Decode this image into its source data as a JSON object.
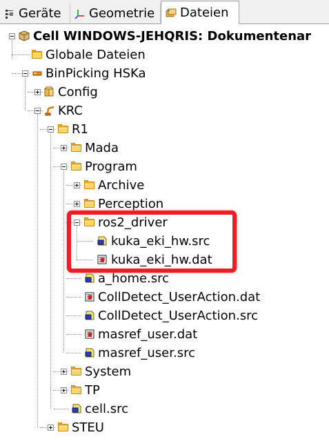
{
  "tabs": [
    {
      "label": "Geräte",
      "icon": "devices-icon",
      "active": false
    },
    {
      "label": "Geometrie",
      "icon": "geometry-axes-icon",
      "active": false
    },
    {
      "label": "Dateien",
      "icon": "files-icon",
      "active": true
    }
  ],
  "tree": {
    "cell": "Cell WINDOWS-JEHQRIS: Dokumentenar",
    "global_files": "Globale Dateien",
    "project": "BinPicking HSKa",
    "config": "Config",
    "krc": "KRC",
    "r1": "R1",
    "mada": "Mada",
    "program": "Program",
    "archive": "Archive",
    "perception": "Perception",
    "ros2_driver": "ros2_driver",
    "kuka_eki_hw_src": "kuka_eki_hw.src",
    "kuka_eki_hw_dat": "kuka_eki_hw.dat",
    "a_home_src": "a_home.src",
    "colldetect_dat": "CollDetect_UserAction.dat",
    "colldetect_src": "CollDetect_UserAction.src",
    "masref_dat": "masref_user.dat",
    "masref_src": "masref_user.src",
    "system": "System",
    "tp": "TP",
    "cell_src": "cell.src",
    "steu": "STEU"
  },
  "colors": {
    "highlight": "#ee1c25",
    "folder": "#f2b640",
    "tab_bar": "#f0f0f0"
  }
}
